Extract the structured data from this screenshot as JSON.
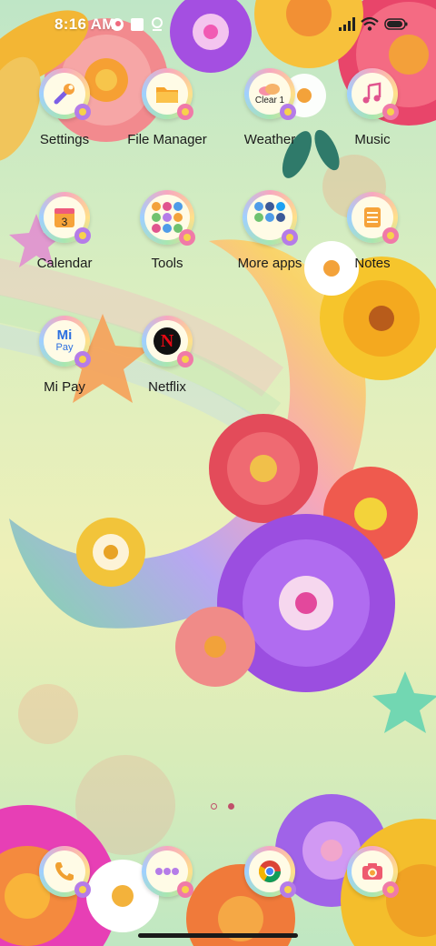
{
  "status_bar": {
    "time": "8:16 AM",
    "battery_level_fraction": 0.9
  },
  "apps": [
    {
      "label": "Settings",
      "icon": "settings-wrench-icon"
    },
    {
      "label": "File Manager",
      "icon": "folder-icon"
    },
    {
      "label": "Weather",
      "icon": "weather-cloud-icon",
      "widget_text": "Clear 1"
    },
    {
      "label": "Music",
      "icon": "music-note-icon"
    },
    {
      "label": "Calendar",
      "icon": "calendar-icon",
      "day_number": "3"
    },
    {
      "label": "Tools",
      "icon": "tools-folder-icon"
    },
    {
      "label": "More apps",
      "icon": "more-apps-folder-icon"
    },
    {
      "label": "Notes",
      "icon": "notes-icon"
    },
    {
      "label": "Mi Pay",
      "icon": "mi-pay-icon",
      "icon_text_top": "Mi",
      "icon_text_bottom": "Pay"
    },
    {
      "label": "Netflix",
      "icon": "netflix-icon",
      "icon_text": "N"
    }
  ],
  "dock": [
    {
      "icon": "phone-icon"
    },
    {
      "icon": "messages-icon"
    },
    {
      "icon": "chrome-icon"
    },
    {
      "icon": "camera-icon"
    }
  ],
  "page_indicator": {
    "pages": 2,
    "current": 2
  },
  "colors": {
    "label_text": "#1b1b1b",
    "status_text": "#ffffff"
  }
}
